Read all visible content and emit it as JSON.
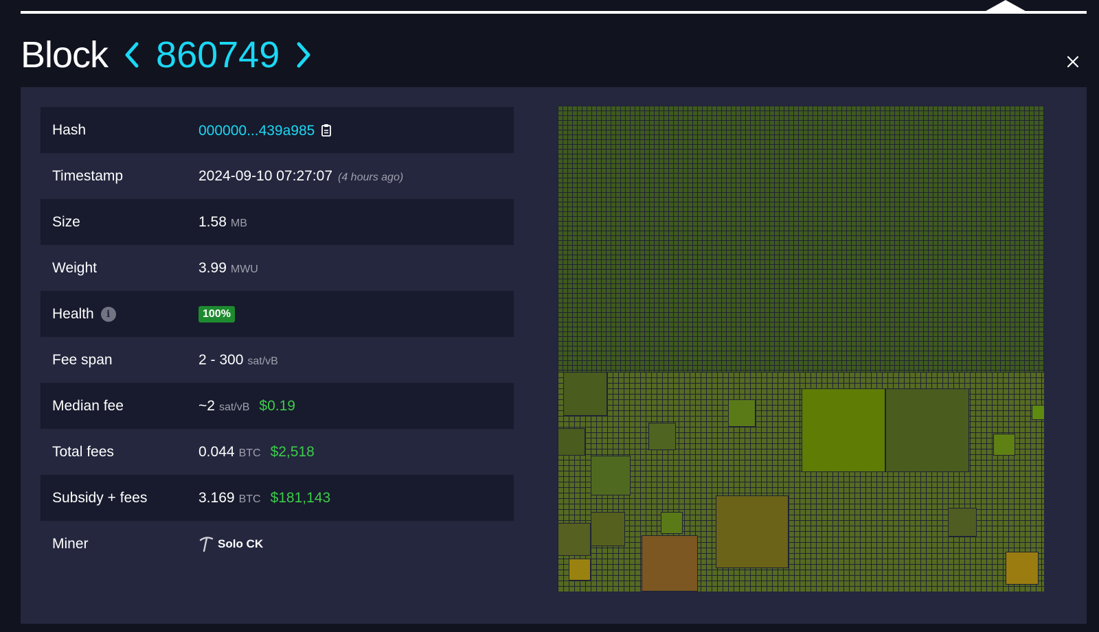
{
  "header": {
    "title": "Block",
    "height": "860749"
  },
  "details": {
    "hash": {
      "label": "Hash",
      "value": "000000...439a985"
    },
    "timestamp": {
      "label": "Timestamp",
      "value": "2024-09-10 07:27:07",
      "relative": "(4 hours ago)"
    },
    "size": {
      "label": "Size",
      "value": "1.58",
      "unit": "MB"
    },
    "weight": {
      "label": "Weight",
      "value": "3.99",
      "unit": "MWU"
    },
    "health": {
      "label": "Health",
      "value": "100%"
    },
    "fee_span": {
      "label": "Fee span",
      "value": "2 - 300",
      "unit": "sat/vB"
    },
    "median_fee": {
      "label": "Median fee",
      "value": "~2",
      "unit": "sat/vB",
      "fiat": "$0.19"
    },
    "total_fees": {
      "label": "Total fees",
      "value": "0.044",
      "unit": "BTC",
      "fiat": "$2,518"
    },
    "subsidy_fees": {
      "label": "Subsidy + fees",
      "value": "3.169",
      "unit": "BTC",
      "fiat": "$181,143"
    },
    "miner": {
      "label": "Miner",
      "value": "Solo CK"
    }
  },
  "colors": {
    "accent": "#1bd8f4",
    "fiat": "#3bcc49",
    "health_badge": "#1d8a2f",
    "panel": "#24273e",
    "background": "#11131f"
  },
  "icons": {
    "prev": "chevron-left-icon",
    "next": "chevron-right-icon",
    "close": "close-icon",
    "copy": "clipboard-icon",
    "info": "info-icon",
    "miner": "pickaxe-icon"
  }
}
